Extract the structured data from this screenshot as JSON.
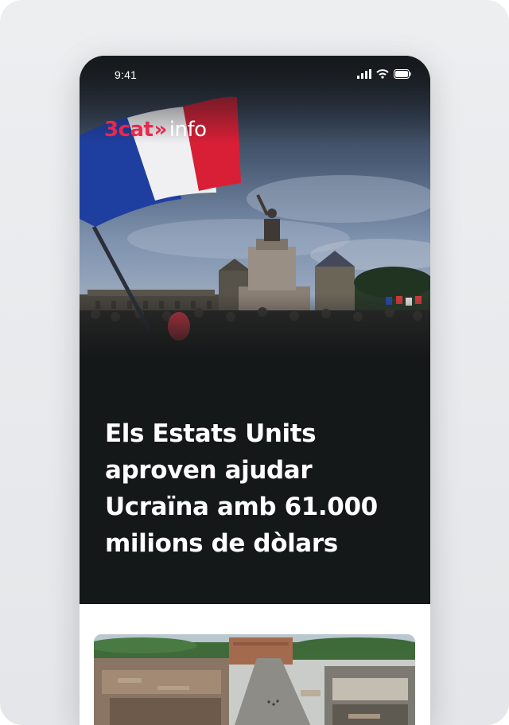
{
  "status_bar": {
    "time": "9:41",
    "icons": [
      "signal-icon",
      "wifi-icon",
      "battery-icon"
    ]
  },
  "brand": {
    "logo_prefix": "3cat",
    "logo_chevron": "»",
    "logo_suffix": "info",
    "accent_color": "#e8284d"
  },
  "hero": {
    "image": "french-flag-crowd-photo",
    "background_color": "#151819"
  },
  "headline": "Els Estats Units aproven ajudar Ucraïna amb 61.000 milions de dòlars",
  "next_card": {
    "image": "tornado-damage-aerial-photo"
  }
}
